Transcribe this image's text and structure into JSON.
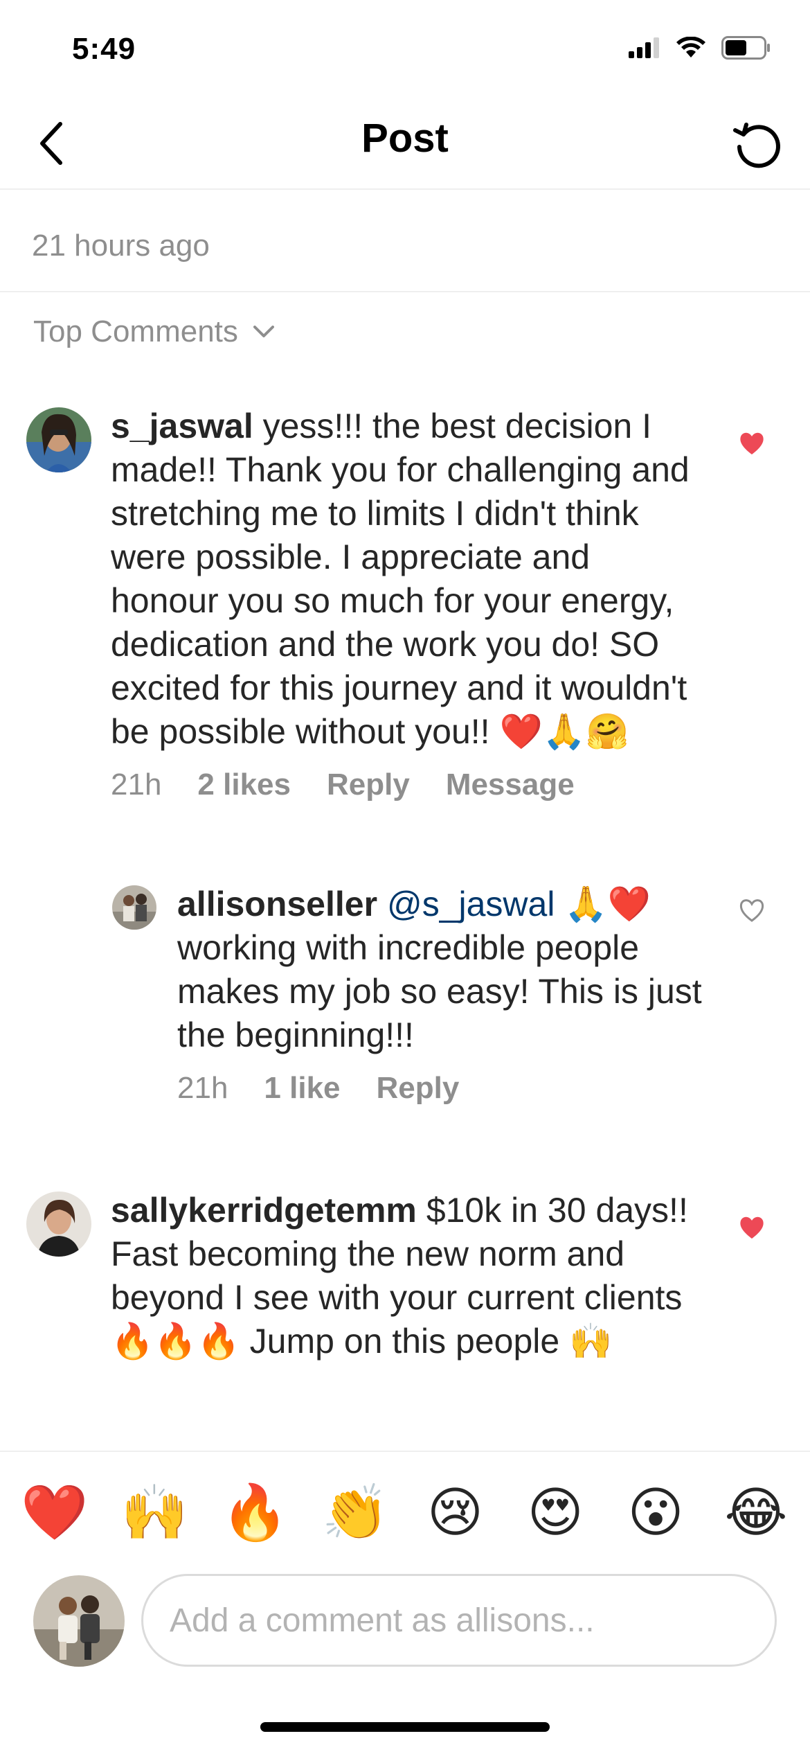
{
  "status_bar": {
    "time": "5:49"
  },
  "nav": {
    "title": "Post"
  },
  "post": {
    "time_ago": "21 hours ago"
  },
  "sort": {
    "label": "Top Comments"
  },
  "comments": [
    {
      "username": "s_jaswal",
      "text": "yess!!! the best decision I made!! Thank you for challenging and stretching me to limits I didn't think were possible. I appreciate and honour you so much for your energy, dedication and the work you do! SO excited for this journey and it wouldn't be possible without you!! ❤️🙏🤗",
      "time": "21h",
      "likes": "2 likes",
      "reply_label": "Reply",
      "message_label": "Message",
      "liked": true
    },
    {
      "username": "allisonseller",
      "mention": "@s_jaswal",
      "text": "🙏❤️ working with incredible people makes my job so easy! This is just the beginning!!!",
      "time": "21h",
      "likes": "1 like",
      "reply_label": "Reply",
      "liked": false
    },
    {
      "username": "sallykerridgetemm",
      "text": "$10k in 30 days!! Fast becoming the new norm and beyond I see with your current clients 🔥🔥🔥 Jump on this people 🙌",
      "liked": true
    }
  ],
  "emoji_bar": [
    "❤️",
    "🙌",
    "🔥",
    "👏",
    "😢",
    "😍",
    "😮",
    "😂"
  ],
  "composer": {
    "placeholder": "Add a comment as allisons..."
  },
  "colors": {
    "heart_liked": "#ed4956",
    "mention": "#00376b",
    "secondary_text": "#8e8e8e"
  }
}
